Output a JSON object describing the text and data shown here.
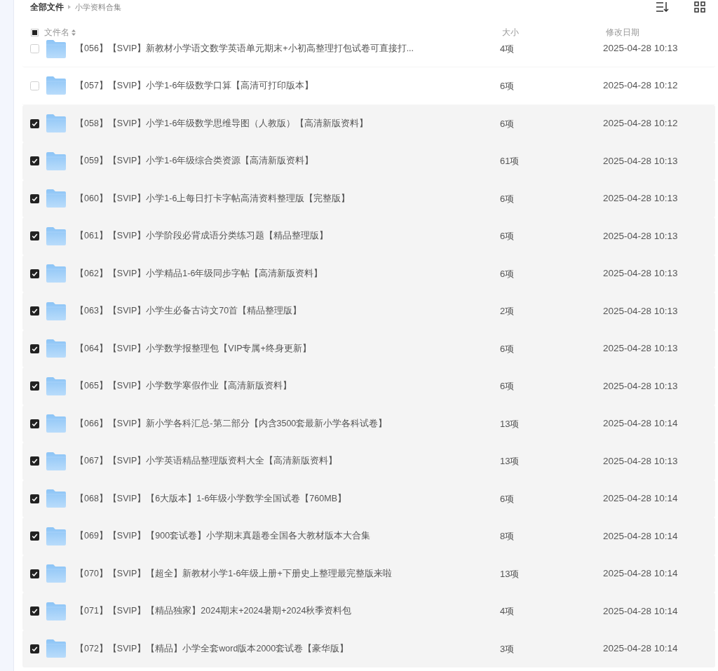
{
  "breadcrumb": [
    {
      "label": "全部文件",
      "current": false
    },
    {
      "label": "小学资料合集",
      "current": true
    }
  ],
  "header": {
    "select_all_partial": true,
    "name": "文件名",
    "size": "大小",
    "date": "修改日期"
  },
  "rows": [
    {
      "name": "【056】【SVIP】新教材小学语文数学英语单元期末+小初高整理打包试卷可直接打...",
      "size": "4项",
      "date": "2025-04-28 10:13",
      "selected": false
    },
    {
      "name": "【057】【SVIP】小学1-6年级数学口算【高清可打印版本】",
      "size": "6项",
      "date": "2025-04-28 10:12",
      "selected": false
    },
    {
      "name": "【058】【SVIP】小学1-6年级数学思维导图（人教版）【高清新版资料】",
      "size": "6项",
      "date": "2025-04-28 10:12",
      "selected": true
    },
    {
      "name": "【059】【SVIP】小学1-6年级综合类资源【高清新版资料】",
      "size": "61项",
      "date": "2025-04-28 10:13",
      "selected": true
    },
    {
      "name": "【060】【SVIP】小学1-6上每日打卡字帖高清资料整理版【完整版】",
      "size": "6项",
      "date": "2025-04-28 10:13",
      "selected": true
    },
    {
      "name": "【061】【SVIP】小学阶段必背成语分类练习题【精品整理版】",
      "size": "6项",
      "date": "2025-04-28 10:13",
      "selected": true
    },
    {
      "name": "【062】【SVIP】小学精品1-6年级同步字帖【高清新版资料】",
      "size": "6项",
      "date": "2025-04-28 10:13",
      "selected": true
    },
    {
      "name": "【063】【SVIP】小学生必备古诗文70首【精品整理版】",
      "size": "2项",
      "date": "2025-04-28 10:13",
      "selected": true
    },
    {
      "name": "【064】【SVIP】小学数学报整理包【VIP专属+终身更新】",
      "size": "6项",
      "date": "2025-04-28 10:13",
      "selected": true
    },
    {
      "name": "【065】【SVIP】小学数学寒假作业【高清新版资料】",
      "size": "6项",
      "date": "2025-04-28 10:13",
      "selected": true
    },
    {
      "name": "【066】【SVIP】新小学各科汇总-第二部分【内含3500套最新小学各科试卷】",
      "size": "13项",
      "date": "2025-04-28 10:14",
      "selected": true
    },
    {
      "name": "【067】【SVIP】小学英语精品整理版资料大全【高清新版资料】",
      "size": "13项",
      "date": "2025-04-28 10:13",
      "selected": true
    },
    {
      "name": "【068】【SVIP】【6大版本】1-6年级小学数学全国试卷【760MB】",
      "size": "6项",
      "date": "2025-04-28 10:14",
      "selected": true
    },
    {
      "name": "【069】【SVIP】【900套试卷】小学期末真题卷全国各大教材版本大合集",
      "size": "8项",
      "date": "2025-04-28 10:14",
      "selected": true
    },
    {
      "name": "【070】【SVIP】【超全】新教材小学1-6年级上册+下册史上整理最完整版来啦",
      "size": "13项",
      "date": "2025-04-28 10:14",
      "selected": true
    },
    {
      "name": "【071】【SVIP】【精品独家】2024期末+2024暑期+2024秋季资料包",
      "size": "4项",
      "date": "2025-04-28 10:14",
      "selected": true
    },
    {
      "name": "【072】【SVIP】【精品】小学全套word版本2000套试卷【豪华版】",
      "size": "3项",
      "date": "2025-04-28 10:14",
      "selected": true
    }
  ]
}
